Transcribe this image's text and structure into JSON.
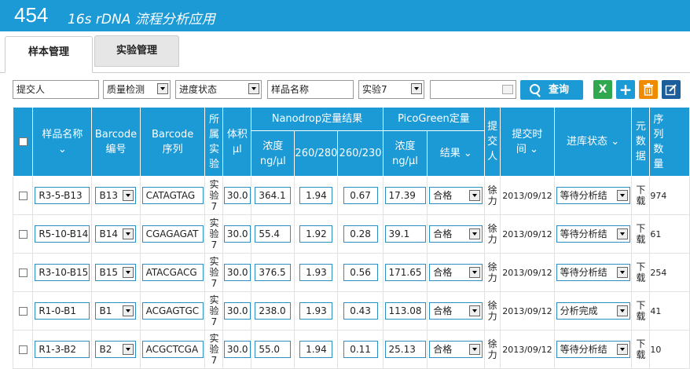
{
  "header": {
    "num": "454",
    "title": "16s rDNA 流程分析应用"
  },
  "tabs": [
    {
      "label": "样本管理"
    },
    {
      "label": "实验管理"
    }
  ],
  "filters": {
    "submitter": "提交人",
    "qc": "质量检测",
    "progress": "进度状态",
    "sample_name": "样品名称",
    "experiment": "实验7",
    "date": "",
    "search": "查询"
  },
  "toolbar_icons": [
    "excel-icon",
    "add-icon",
    "delete-icon",
    "edit-icon"
  ],
  "colors": {
    "primary": "#1b9ad6",
    "excel": "#2fa84f",
    "add": "#1b9ad6",
    "delete": "#f08a00",
    "edit": "#1c5e9c"
  },
  "table": {
    "headers": {
      "sample_name": "样品名称",
      "barcode_no": "Barcode编号",
      "barcode_seq": "Barcode序列",
      "experiment": "所属实验",
      "volume": "体积μl",
      "nanodrop": "Nanodrop定量结果",
      "conc": "浓度ng/μl",
      "r260280": "260/280",
      "r260230": "260/230",
      "picogreen": "PicoGreen定量",
      "pg_conc": "浓度ng/μl",
      "result": "结果",
      "submitter": "提交人",
      "submit_time": "提交时间",
      "status": "进库状态",
      "metadata": "元数据",
      "sequence": "序列数量"
    },
    "rows": [
      {
        "name": "R3-5-B13",
        "barcode": "B13",
        "seq": "CATAGTAG",
        "exp1": "实验",
        "exp2": "7",
        "vol": "30.0",
        "conc": "364.1",
        "r1": "1.94",
        "r2": "0.67",
        "pg": "17.39",
        "res": "合格",
        "sub": "徐力",
        "time": "2013/09/12",
        "status": "等待分析结",
        "meta": "下载",
        "count": "974"
      },
      {
        "name": "R5-10-B14",
        "barcode": "B14",
        "seq": "CGAGAGAT",
        "exp1": "实验",
        "exp2": "7",
        "vol": "30.0",
        "conc": "55.4",
        "r1": "1.92",
        "r2": "0.28",
        "pg": "39.1",
        "res": "合格",
        "sub": "徐力",
        "time": "2013/09/12",
        "status": "等待分析结",
        "meta": "下载",
        "count": "61"
      },
      {
        "name": "R3-10-B15",
        "barcode": "B15",
        "seq": "ATACGACG",
        "exp1": "实验",
        "exp2": "7",
        "vol": "30.0",
        "conc": "376.5",
        "r1": "1.93",
        "r2": "0.56",
        "pg": "171.65",
        "res": "合格",
        "sub": "徐力",
        "time": "2013/09/12",
        "status": "等待分析结",
        "meta": "下载",
        "count": "254"
      },
      {
        "name": "R1-0-B1",
        "barcode": "B1",
        "seq": "ACGAGTGC",
        "exp1": "实验",
        "exp2": "7",
        "vol": "30.0",
        "conc": "238.0",
        "r1": "1.93",
        "r2": "0.43",
        "pg": "113.08",
        "res": "合格",
        "sub": "徐力",
        "time": "2013/09/12",
        "status": "分析完成",
        "meta": "下载",
        "count": "41"
      },
      {
        "name": "R1-3-B2",
        "barcode": "B2",
        "seq": "ACGCTCGA",
        "exp1": "实验",
        "exp2": "7",
        "vol": "30.0",
        "conc": "55.0",
        "r1": "1.94",
        "r2": "0.11",
        "pg": "25.13",
        "res": "合格",
        "sub": "徐力",
        "time": "2013/09/12",
        "status": "等待分析结",
        "meta": "下载",
        "count": "10"
      }
    ]
  }
}
